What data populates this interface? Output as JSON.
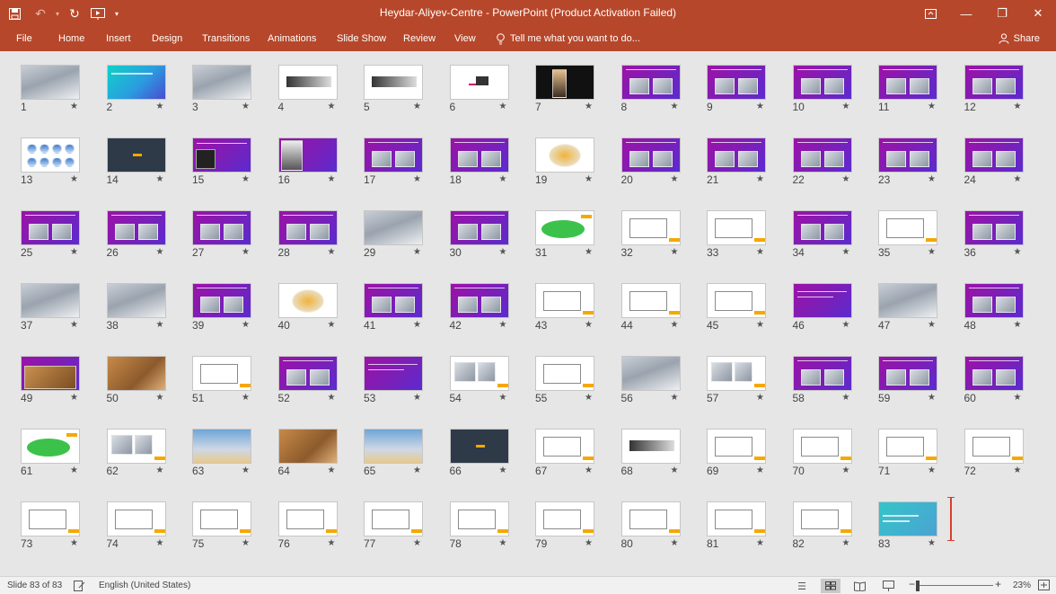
{
  "window": {
    "title": "Heydar-Aliyev-Centre - PowerPoint (Product Activation Failed)"
  },
  "ribbon": {
    "tabs": [
      "File",
      "Home",
      "Insert",
      "Design",
      "Transitions",
      "Animations",
      "Slide Show",
      "Review",
      "View"
    ],
    "tell_me": "Tell me what you want to do...",
    "share": "Share"
  },
  "colors": {
    "accent": "#b7472a",
    "slide_purple": "#8e17b0",
    "slide_highlight": "#f5a800"
  },
  "sorter": {
    "star_glyph": "★",
    "slides": [
      {
        "n": "1",
        "kind": "photo"
      },
      {
        "n": "2",
        "kind": "teal"
      },
      {
        "n": "3",
        "kind": "photo"
      },
      {
        "n": "4",
        "kind": "white-building"
      },
      {
        "n": "5",
        "kind": "white-building"
      },
      {
        "n": "6",
        "kind": "white-logo"
      },
      {
        "n": "7",
        "kind": "portrait"
      },
      {
        "n": "8",
        "kind": "purple-photos"
      },
      {
        "n": "9",
        "kind": "purple-photos"
      },
      {
        "n": "10",
        "kind": "purple-photos"
      },
      {
        "n": "11",
        "kind": "purple-photos"
      },
      {
        "n": "12",
        "kind": "purple-photos"
      },
      {
        "n": "13",
        "kind": "white-grid"
      },
      {
        "n": "14",
        "kind": "dark"
      },
      {
        "n": "15",
        "kind": "purple-dark"
      },
      {
        "n": "16",
        "kind": "purple-portrait"
      },
      {
        "n": "17",
        "kind": "purple-photos"
      },
      {
        "n": "18",
        "kind": "purple-photos"
      },
      {
        "n": "19",
        "kind": "white-diagram"
      },
      {
        "n": "20",
        "kind": "purple-photos"
      },
      {
        "n": "21",
        "kind": "purple-photos"
      },
      {
        "n": "22",
        "kind": "purple-photos"
      },
      {
        "n": "23",
        "kind": "purple-photos"
      },
      {
        "n": "24",
        "kind": "purple-photos"
      },
      {
        "n": "25",
        "kind": "purple-photos"
      },
      {
        "n": "26",
        "kind": "purple-photos"
      },
      {
        "n": "27",
        "kind": "purple-photos"
      },
      {
        "n": "28",
        "kind": "purple-photos"
      },
      {
        "n": "29",
        "kind": "photo"
      },
      {
        "n": "30",
        "kind": "purple-photos"
      },
      {
        "n": "31",
        "kind": "white-green"
      },
      {
        "n": "32",
        "kind": "white-sketch"
      },
      {
        "n": "33",
        "kind": "white-sketch"
      },
      {
        "n": "34",
        "kind": "purple-photos"
      },
      {
        "n": "35",
        "kind": "white-sketch"
      },
      {
        "n": "36",
        "kind": "purple-photos"
      },
      {
        "n": "37",
        "kind": "photo"
      },
      {
        "n": "38",
        "kind": "photo"
      },
      {
        "n": "39",
        "kind": "purple-photos"
      },
      {
        "n": "40",
        "kind": "white-diagram"
      },
      {
        "n": "41",
        "kind": "purple-photos"
      },
      {
        "n": "42",
        "kind": "purple-photos"
      },
      {
        "n": "43",
        "kind": "white-sketch"
      },
      {
        "n": "44",
        "kind": "white-sketch"
      },
      {
        "n": "45",
        "kind": "white-sketch"
      },
      {
        "n": "46",
        "kind": "purple"
      },
      {
        "n": "47",
        "kind": "photo"
      },
      {
        "n": "48",
        "kind": "purple-photos"
      },
      {
        "n": "49",
        "kind": "purple-warm"
      },
      {
        "n": "50",
        "kind": "warm"
      },
      {
        "n": "51",
        "kind": "white-sketch"
      },
      {
        "n": "52",
        "kind": "purple-photos"
      },
      {
        "n": "53",
        "kind": "purple"
      },
      {
        "n": "54",
        "kind": "white-photos"
      },
      {
        "n": "55",
        "kind": "white-sketch"
      },
      {
        "n": "56",
        "kind": "photo"
      },
      {
        "n": "57",
        "kind": "white-photos"
      },
      {
        "n": "58",
        "kind": "purple-photos"
      },
      {
        "n": "59",
        "kind": "purple-photos"
      },
      {
        "n": "60",
        "kind": "purple-photos"
      },
      {
        "n": "61",
        "kind": "white-green"
      },
      {
        "n": "62",
        "kind": "white-photos"
      },
      {
        "n": "63",
        "kind": "sky"
      },
      {
        "n": "64",
        "kind": "warm"
      },
      {
        "n": "65",
        "kind": "sky"
      },
      {
        "n": "66",
        "kind": "dark"
      },
      {
        "n": "67",
        "kind": "white-sketch"
      },
      {
        "n": "68",
        "kind": "white-building"
      },
      {
        "n": "69",
        "kind": "white-sketch"
      },
      {
        "n": "70",
        "kind": "white-sketch"
      },
      {
        "n": "71",
        "kind": "white-sketch"
      },
      {
        "n": "72",
        "kind": "white-sketch"
      },
      {
        "n": "73",
        "kind": "white-sketch"
      },
      {
        "n": "74",
        "kind": "white-sketch"
      },
      {
        "n": "75",
        "kind": "white-sketch"
      },
      {
        "n": "76",
        "kind": "white-sketch"
      },
      {
        "n": "77",
        "kind": "white-sketch"
      },
      {
        "n": "78",
        "kind": "white-sketch"
      },
      {
        "n": "79",
        "kind": "white-sketch"
      },
      {
        "n": "80",
        "kind": "white-sketch"
      },
      {
        "n": "81",
        "kind": "white-sketch"
      },
      {
        "n": "82",
        "kind": "white-sketch"
      },
      {
        "n": "83",
        "kind": "teal-soft"
      }
    ]
  },
  "status": {
    "slide_counter": "Slide 83 of 83",
    "language": "English (United States)",
    "zoom": "23%"
  }
}
